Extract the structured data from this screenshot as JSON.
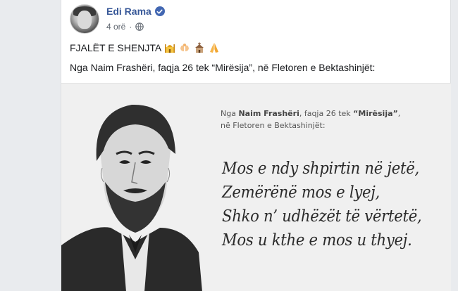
{
  "author": {
    "name": "Edi Rama",
    "time": "4 orë",
    "verified": true
  },
  "post": {
    "line1": "FJALËT E SHENJTA",
    "line1_emojis": [
      "mosque-emoji",
      "hands-emoji",
      "church-emoji",
      "praying-hands-emoji"
    ],
    "line2": "Nga Naim Frashëri, faqja 26 tek “Mirësija”, në Fletoren e Bektashinjët:"
  },
  "image": {
    "caption_prefix": "Nga ",
    "caption_author": "Naim Frashëri",
    "caption_mid": ", faqja 26 tek ",
    "caption_title": "“Mirësija”",
    "caption_end": ",",
    "caption_line2": "në Fletoren e Bektashinjët:",
    "poem": [
      "Mos e ndy shpirtin në jetë,",
      "Zemërënë mos e lyej,",
      "Shko n’ udhëzët të vërtetë,",
      "Mos u kthe e mos u thyej."
    ]
  },
  "colors": {
    "link": "#385898",
    "verified": "#4267b2",
    "meta": "#606770"
  }
}
